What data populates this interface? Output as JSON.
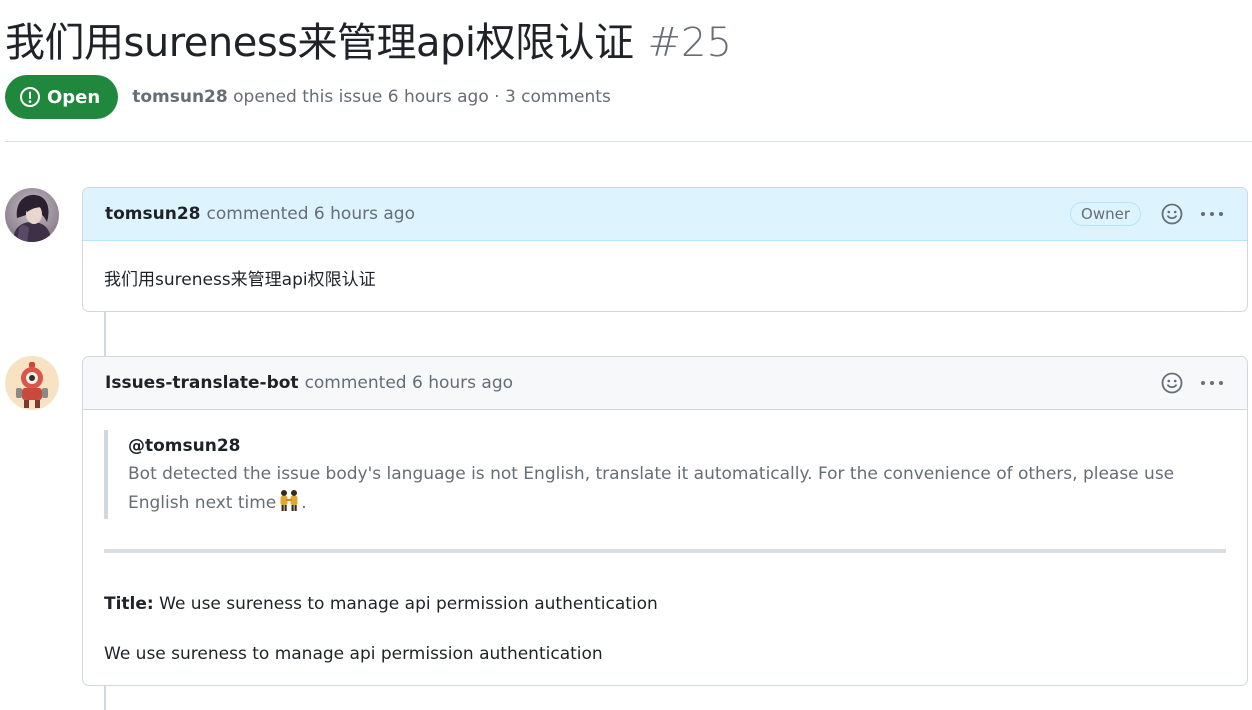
{
  "issue": {
    "title": "我们用sureness来管理api权限认证",
    "number": "#25",
    "state": "Open",
    "author": "tomsun28",
    "opened_text": "opened this issue 6 hours ago · 3 comments"
  },
  "comments": [
    {
      "author": "tomsun28",
      "action": "commented 6 hours ago",
      "role_badge": "Owner",
      "avatar_icon": "user-avatar-icon",
      "body": "我们用sureness来管理api权限认证"
    },
    {
      "author": "Issues-translate-bot",
      "action": "commented 6 hours ago",
      "avatar_icon": "bot-avatar-icon",
      "quote_mention": "@tomsun28",
      "quote_text_1": "Bot detected the issue body's language is not English, translate it automatically. For the convenience of others, please use English next time",
      "quote_text_end": ".",
      "title_label": "Title:",
      "title_value": "We use sureness to manage api permission authentication",
      "body": "We use sureness to manage api permission authentication"
    }
  ],
  "colors": {
    "open_badge": "#1f883d",
    "owner_header": "#ddf4ff",
    "muted_text": "#656d76"
  }
}
